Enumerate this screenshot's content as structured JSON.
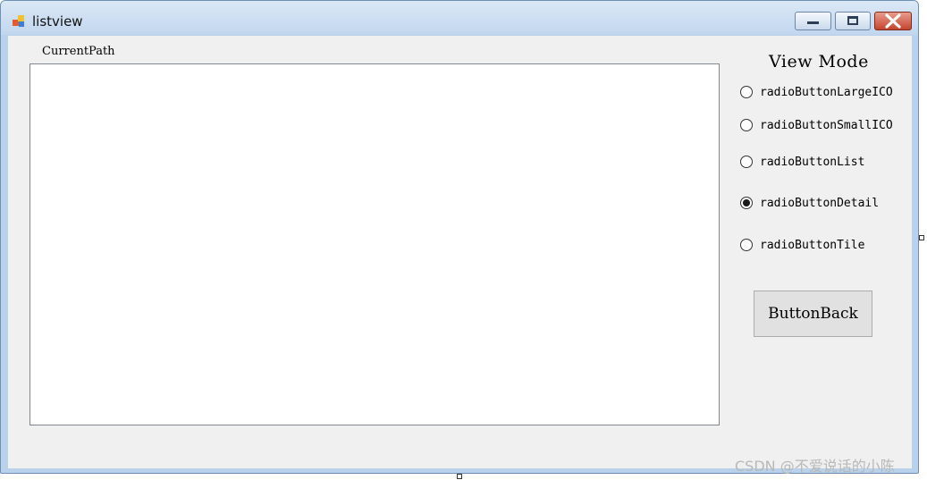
{
  "window": {
    "title": "listview",
    "app_icon": "winforms-app-icon",
    "controls": [
      "minimize-icon",
      "maximize-icon",
      "close-icon"
    ]
  },
  "main": {
    "current_path_label": "CurrentPath",
    "list_view_items": []
  },
  "view_mode": {
    "title": "View Mode",
    "options": [
      {
        "label": "radioButtonLargeICO",
        "checked": false
      },
      {
        "label": "radioButtonSmallICO",
        "checked": false
      },
      {
        "label": "radioButtonList",
        "checked": false
      },
      {
        "label": "radioButtonDetail",
        "checked": true
      },
      {
        "label": "radioButtonTile",
        "checked": false
      }
    ],
    "back_button_label": "ButtonBack"
  },
  "watermark": "CSDN @不爱说话的小陈"
}
